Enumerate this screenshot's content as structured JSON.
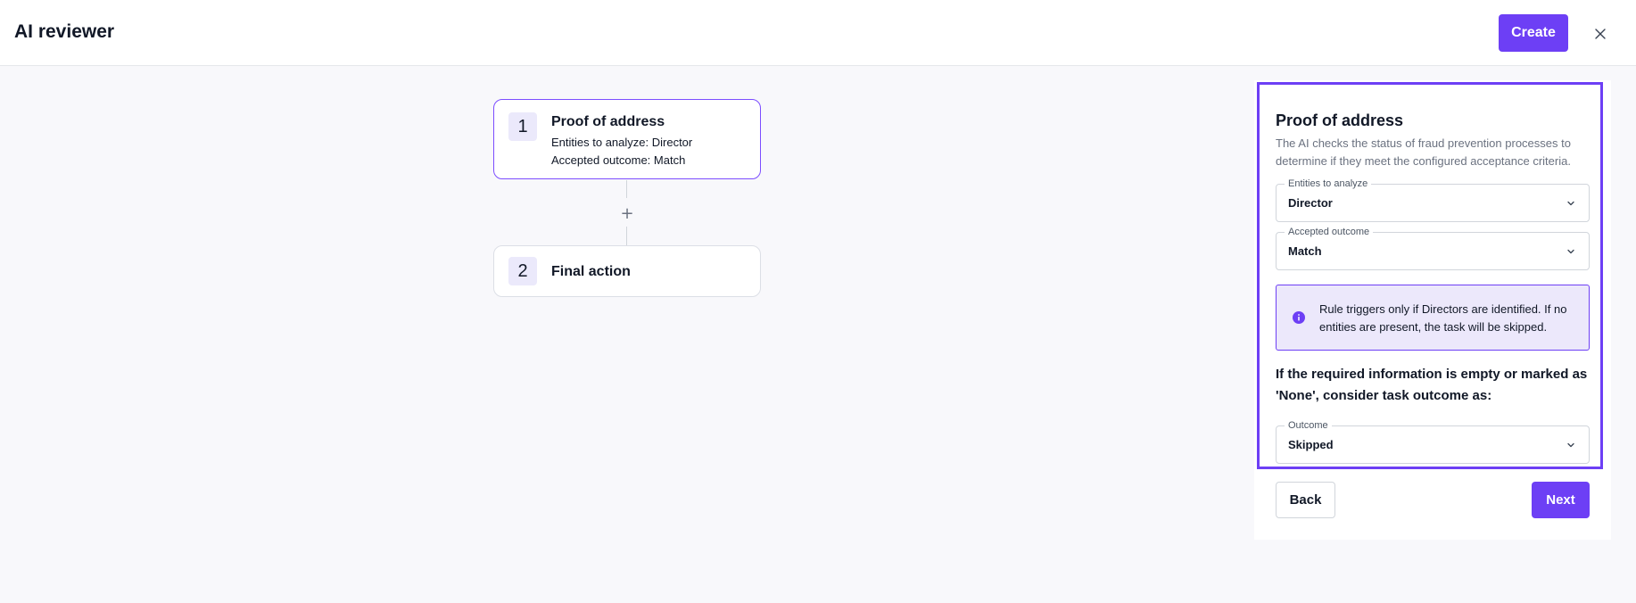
{
  "header": {
    "title": "AI reviewer",
    "create_label": "Create",
    "close_icon": "close-icon"
  },
  "workflow": {
    "steps": [
      {
        "number": "1",
        "title": "Proof of address",
        "lines": [
          "Entities to analyze: Director",
          "Accepted outcome: Match"
        ],
        "selected": true
      },
      {
        "number": "2",
        "title": "Final action",
        "lines": [],
        "selected": false
      }
    ],
    "add_symbol": "+"
  },
  "panel": {
    "title": "Proof of address",
    "description": "The AI checks the status of fraud prevention processes to determine if they meet the configured acceptance criteria.",
    "fields": {
      "entities": {
        "label": "Entities to analyze",
        "value": "Director"
      },
      "accepted_outcome": {
        "label": "Accepted outcome",
        "value": "Match"
      },
      "outcome": {
        "label": "Outcome",
        "value": "Skipped"
      }
    },
    "info": {
      "icon": "info-icon",
      "text": "Rule triggers only if Directors are identified. If no entities are present, the task will be skipped."
    },
    "question": "If the required information is empty or marked as 'None', consider task outcome as:",
    "back_label": "Back",
    "next_label": "Next"
  },
  "colors": {
    "accent": "#6d3ff5",
    "info_bg": "#ece8fb",
    "canvas_bg": "#f8f8fb"
  }
}
